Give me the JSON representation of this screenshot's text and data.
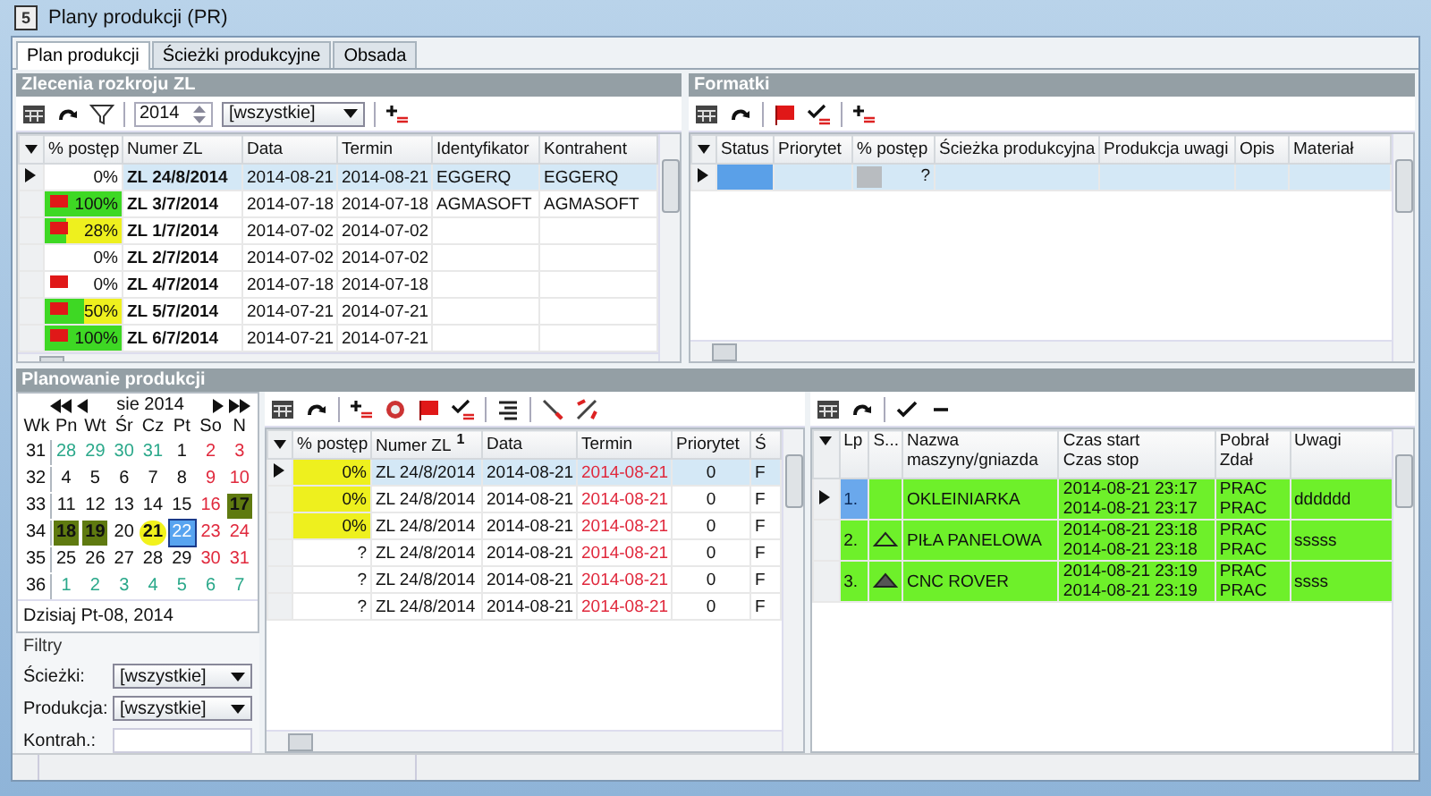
{
  "window": {
    "app_icon": "5",
    "title": "Plany produkcji (PR)"
  },
  "tabs": [
    {
      "label": "Plan produkcji",
      "selected": true
    },
    {
      "label": "Ścieżki produkcyjne",
      "selected": false
    },
    {
      "label": "Obsada",
      "selected": false
    }
  ],
  "orders": {
    "title": "Zlecenia rozkroju ZL",
    "year": "2014",
    "filter": "[wszystkie]",
    "columns": [
      "% postęp",
      "Numer ZL",
      "Data",
      "Termin",
      "Identyfikator",
      "Kontrahent"
    ],
    "rows": [
      {
        "progress": "0%",
        "color": "#ffffff",
        "flag": false,
        "number": "ZL 24/8/2014",
        "date": "2014-08-21",
        "deadline": "2014-08-21",
        "identifier": "EGGERQ",
        "contractor": "EGGERQ",
        "selected": true
      },
      {
        "progress": "100%",
        "level": 1,
        "flag": true,
        "number": "ZL 3/7/2014",
        "date": "2014-07-18",
        "deadline": "2014-07-18",
        "identifier": "AGMASOFT",
        "contractor": "AGMASOFT",
        "selected": false
      },
      {
        "progress": "28%",
        "level": 0.28,
        "color": "#eef01e",
        "flag": true,
        "number": "ZL 1/7/2014",
        "date": "2014-07-02",
        "deadline": "2014-07-02",
        "selected": false
      },
      {
        "progress": "0%",
        "color": "#ffffff",
        "flag": false,
        "number": "ZL 2/7/2014",
        "date": "2014-07-02",
        "deadline": "2014-07-02",
        "selected": false
      },
      {
        "progress": "0%",
        "color": "#ffffff",
        "flag": true,
        "number": "ZL 4/7/2014",
        "date": "2014-07-18",
        "deadline": "2014-07-18",
        "selected": false
      },
      {
        "progress": "50%",
        "level": 0.5,
        "color": "#eef01e",
        "flag": true,
        "number": "ZL 5/7/2014",
        "date": "2014-07-21",
        "deadline": "2014-07-21",
        "selected": false
      },
      {
        "progress": "100%",
        "level": 1,
        "flag": true,
        "number": "ZL 6/7/2014",
        "date": "2014-07-21",
        "deadline": "2014-07-21",
        "selected": false
      }
    ]
  },
  "formatki": {
    "title": "Formatki",
    "columns": [
      "Status",
      "Priorytet",
      "% postęp",
      "Ścieżka produkcyjna",
      "Produkcja uwagi",
      "Opis",
      "Materiał"
    ],
    "rows": [
      {
        "progress": "?",
        "selected": true
      }
    ]
  },
  "planning": {
    "title": "Planowanie produkcji",
    "calendar": {
      "month": "sie 2014",
      "headers": [
        "Wk",
        "Pn",
        "Wt",
        "Śr",
        "Cz",
        "Pt",
        "So",
        "N"
      ],
      "weeks": [
        {
          "wk": "31",
          "days": [
            {
              "d": "28",
              "kind": "adjacent",
              "selected": false
            },
            {
              "d": "29",
              "kind": "adjacent",
              "selected": false
            },
            {
              "d": "30",
              "kind": "adjacent",
              "selected": false
            },
            {
              "d": "31",
              "kind": "adjacent",
              "selected": false
            },
            {
              "d": "1",
              "kind": "weekday",
              "selected": false
            },
            {
              "d": "2",
              "kind": "weekend",
              "selected": false
            },
            {
              "d": "3",
              "kind": "weekend",
              "selected": false
            }
          ]
        },
        {
          "wk": "32",
          "days": [
            {
              "d": "4",
              "kind": "weekday",
              "selected": false
            },
            {
              "d": "5",
              "kind": "weekday",
              "selected": false
            },
            {
              "d": "6",
              "kind": "weekday",
              "selected": false
            },
            {
              "d": "7",
              "kind": "weekday",
              "selected": false
            },
            {
              "d": "8",
              "kind": "weekday",
              "selected": false
            },
            {
              "d": "9",
              "kind": "weekend",
              "selected": false
            },
            {
              "d": "10",
              "kind": "weekend",
              "selected": false
            }
          ]
        },
        {
          "wk": "33",
          "days": [
            {
              "d": "11",
              "kind": "weekday",
              "selected": false
            },
            {
              "d": "12",
              "kind": "weekday",
              "selected": false
            },
            {
              "d": "13",
              "kind": "weekday",
              "selected": false
            },
            {
              "d": "14",
              "kind": "weekday",
              "selected": false
            },
            {
              "d": "15",
              "kind": "weekday",
              "selected": false
            },
            {
              "d": "16",
              "kind": "weekend",
              "selected": false
            },
            {
              "d": "17",
              "kind": "planned",
              "selected": false
            }
          ]
        },
        {
          "wk": "34",
          "days": [
            {
              "d": "18",
              "kind": "planned",
              "selected": false
            },
            {
              "d": "19",
              "kind": "planned",
              "selected": false
            },
            {
              "d": "20",
              "kind": "weekday",
              "selected": false
            },
            {
              "d": "21",
              "kind": "marked",
              "selected": false
            },
            {
              "d": "22",
              "kind": "weekday",
              "selected": true
            },
            {
              "d": "23",
              "kind": "weekend",
              "selected": false
            },
            {
              "d": "24",
              "kind": "weekend",
              "selected": false
            }
          ]
        },
        {
          "wk": "35",
          "days": [
            {
              "d": "25",
              "kind": "weekday",
              "selected": false
            },
            {
              "d": "26",
              "kind": "weekday",
              "selected": false
            },
            {
              "d": "27",
              "kind": "weekday",
              "selected": false
            },
            {
              "d": "28",
              "kind": "weekday",
              "selected": false
            },
            {
              "d": "29",
              "kind": "weekday",
              "selected": false
            },
            {
              "d": "30",
              "kind": "weekend",
              "selected": false
            },
            {
              "d": "31",
              "kind": "weekend",
              "selected": false
            }
          ]
        },
        {
          "wk": "36",
          "days": [
            {
              "d": "1",
              "kind": "adjacent",
              "selected": false
            },
            {
              "d": "2",
              "kind": "adjacent",
              "selected": false
            },
            {
              "d": "3",
              "kind": "adjacent",
              "selected": false
            },
            {
              "d": "4",
              "kind": "adjacent",
              "selected": false
            },
            {
              "d": "5",
              "kind": "adjacent",
              "selected": false
            },
            {
              "d": "6",
              "kind": "adjacent",
              "selected": false
            },
            {
              "d": "7",
              "kind": "adjacent",
              "selected": false
            }
          ]
        }
      ],
      "today": "Dzisiaj Pt-08, 2014"
    },
    "filters": {
      "title": "Filtry",
      "fields": [
        {
          "label": "Ścieżki:",
          "kind": "select",
          "value": "[wszystkie]"
        },
        {
          "label": "Produkcja:",
          "kind": "select",
          "value": "[wszystkie]"
        },
        {
          "label": "Kontrah.:",
          "kind": "input"
        }
      ]
    },
    "orders_table": {
      "columns": [
        {
          "label": "% postęp"
        },
        {
          "label": "Numer ZL",
          "sort": "1"
        },
        {
          "label": "Data"
        },
        {
          "label": "Termin"
        },
        {
          "label": "Priorytet"
        },
        {
          "label": "Ś"
        }
      ],
      "rows": [
        {
          "progress": "0%",
          "color": "#eef01e",
          "number": "ZL 24/8/2014",
          "date": "2014-08-21",
          "deadline": "2014-08-21",
          "priority": "0",
          "column_6": "F",
          "selected": true
        },
        {
          "progress": "0%",
          "color": "#eef01e",
          "number": "ZL 24/8/2014",
          "date": "2014-08-21",
          "deadline": "2014-08-21",
          "priority": "0",
          "column_6": "F",
          "selected": false
        },
        {
          "progress": "0%",
          "color": "#eef01e",
          "number": "ZL 24/8/2014",
          "date": "2014-08-21",
          "deadline": "2014-08-21",
          "priority": "0",
          "column_6": "F",
          "selected": false
        },
        {
          "progress": "?",
          "color": "#ffffff",
          "number": "ZL 24/8/2014",
          "date": "2014-08-21",
          "deadline": "2014-08-21",
          "priority": "0",
          "column_6": "F",
          "selected": false
        },
        {
          "progress": "?",
          "color": "#ffffff",
          "number": "ZL 24/8/2014",
          "date": "2014-08-21",
          "deadline": "2014-08-21",
          "priority": "0",
          "column_6": "F",
          "selected": false
        },
        {
          "progress": "?",
          "color": "#ffffff",
          "number": "ZL 24/8/2014",
          "date": "2014-08-21",
          "deadline": "2014-08-21",
          "priority": "0",
          "column_6": "F",
          "selected": false
        }
      ]
    },
    "operations": {
      "columns": [
        {
          "label": "Lp"
        },
        {
          "label": "S..."
        },
        {
          "label": "Nazwa",
          "label2": "maszyny/gniazda"
        },
        {
          "label": "Czas start",
          "label2": "Czas stop"
        },
        {
          "label": "Pobrał",
          "label2": "Zdał"
        },
        {
          "label": "Uwagi"
        }
      ],
      "rows": [
        {
          "lp": "1.",
          "kind": "none",
          "name": "OKLEINIARKA",
          "start": "2014-08-21 23:17",
          "stop": "2014-08-21 23:17",
          "taken": "PRAC",
          "returned": "PRAC",
          "notes": "dddddd",
          "selected": true
        },
        {
          "lp": "2.",
          "kind": "outline",
          "name": "PIŁA PANELOWA",
          "start": "2014-08-21 23:18",
          "stop": "2014-08-21 23:18",
          "taken": "PRAC",
          "returned": "PRAC",
          "notes": "sssss",
          "selected": false
        },
        {
          "lp": "3.",
          "kind": "filled",
          "name": "CNC ROVER",
          "start": "2014-08-21 23:19",
          "stop": "2014-08-21 23:19",
          "taken": "PRAC",
          "returned": "PRAC",
          "notes": "ssss",
          "selected": false
        }
      ]
    }
  }
}
